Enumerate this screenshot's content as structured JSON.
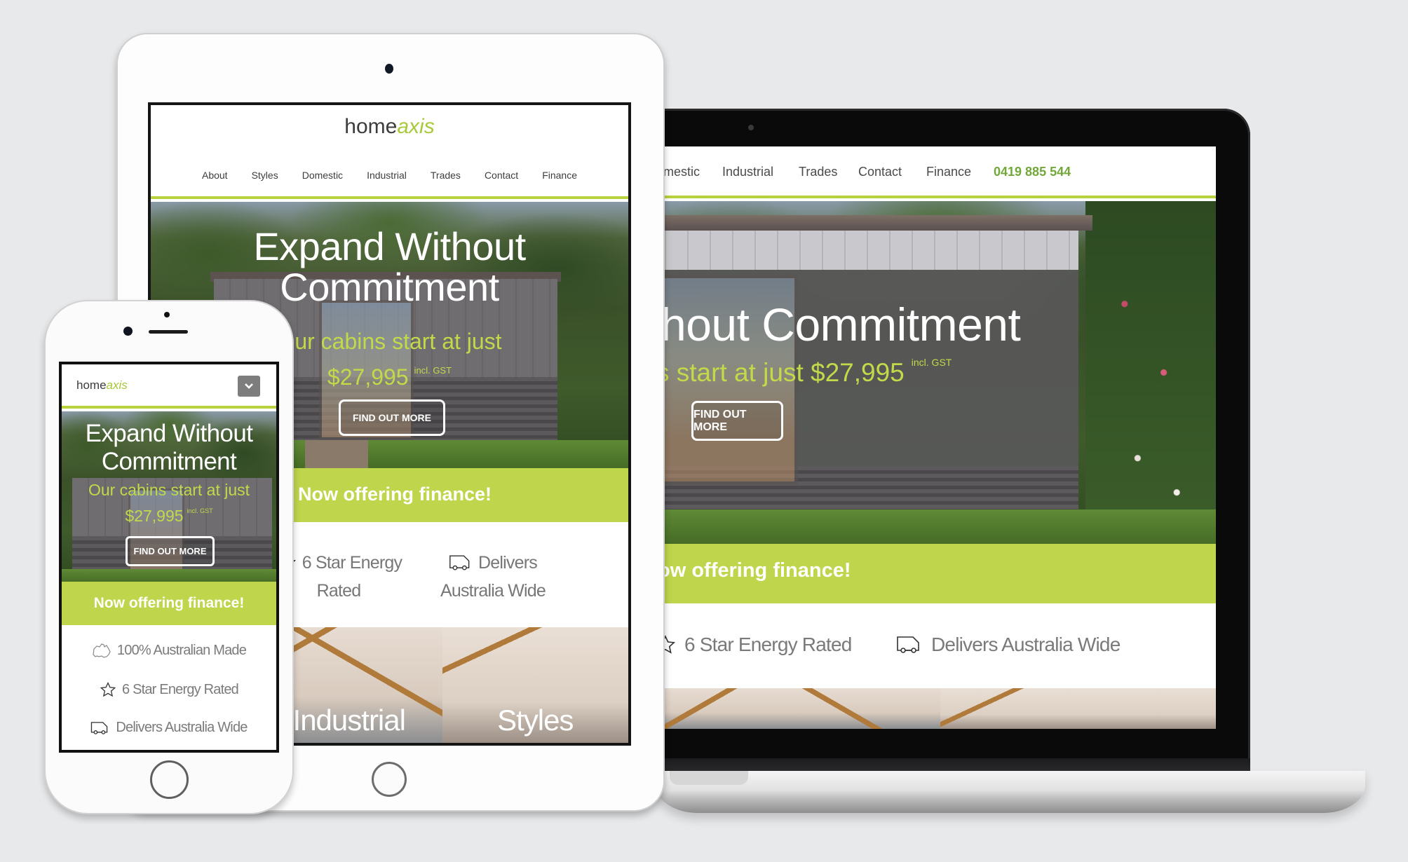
{
  "site": {
    "brand": {
      "part1": "home",
      "part2": "axis"
    },
    "colors": {
      "accent_green": "#bfd54b",
      "phone_green": "#72a83a",
      "text_green": "#c2d94a",
      "background": "#e8e9eb"
    },
    "nav": [
      "About",
      "Styles",
      "Domestic",
      "Industrial",
      "Trades",
      "Contact",
      "Finance"
    ],
    "phone_number": "0419 885 544",
    "hero": {
      "title": "Expand Without Commitment",
      "title_line1": "Expand Without",
      "title_line2": "Commitment",
      "subtitle": "Our cabins start at just",
      "price": "$27,995",
      "price_note": "incl. GST",
      "cta": "FIND OUT MORE"
    },
    "finance_banner": "Now offering finance!",
    "features": [
      {
        "icon": "australia-map-icon",
        "label": "100% Australian Made"
      },
      {
        "icon": "star-outline-icon",
        "label": "6 Star Energy Rated"
      },
      {
        "icon": "delivery-van-icon",
        "label": "Delivers Australia Wide"
      }
    ],
    "tiles": [
      "Industrial",
      "Styles"
    ]
  },
  "laptop": {
    "nav_visible": [
      "mestic",
      "Industrial",
      "Trades",
      "Contact",
      "Finance"
    ],
    "hero_title_visible": "ithout Commitment",
    "hero_sub_visible": "s start at just $27,995",
    "finance_visible": "ow offering finance!",
    "features_visible": [
      "6 Star Energy Rated",
      "Delivers Australia Wide"
    ]
  },
  "tablet": {
    "hero_sub_visible": "ur cabins start at just",
    "finance_visible": "Now offering finance!",
    "feature_star_line1": "6 Star Energy",
    "feature_star_line2": "Rated",
    "feature_van_line1": "Delivers",
    "feature_van_line2": "Australia Wide"
  },
  "phone": {
    "menu_icon": "chevron-down-icon"
  }
}
